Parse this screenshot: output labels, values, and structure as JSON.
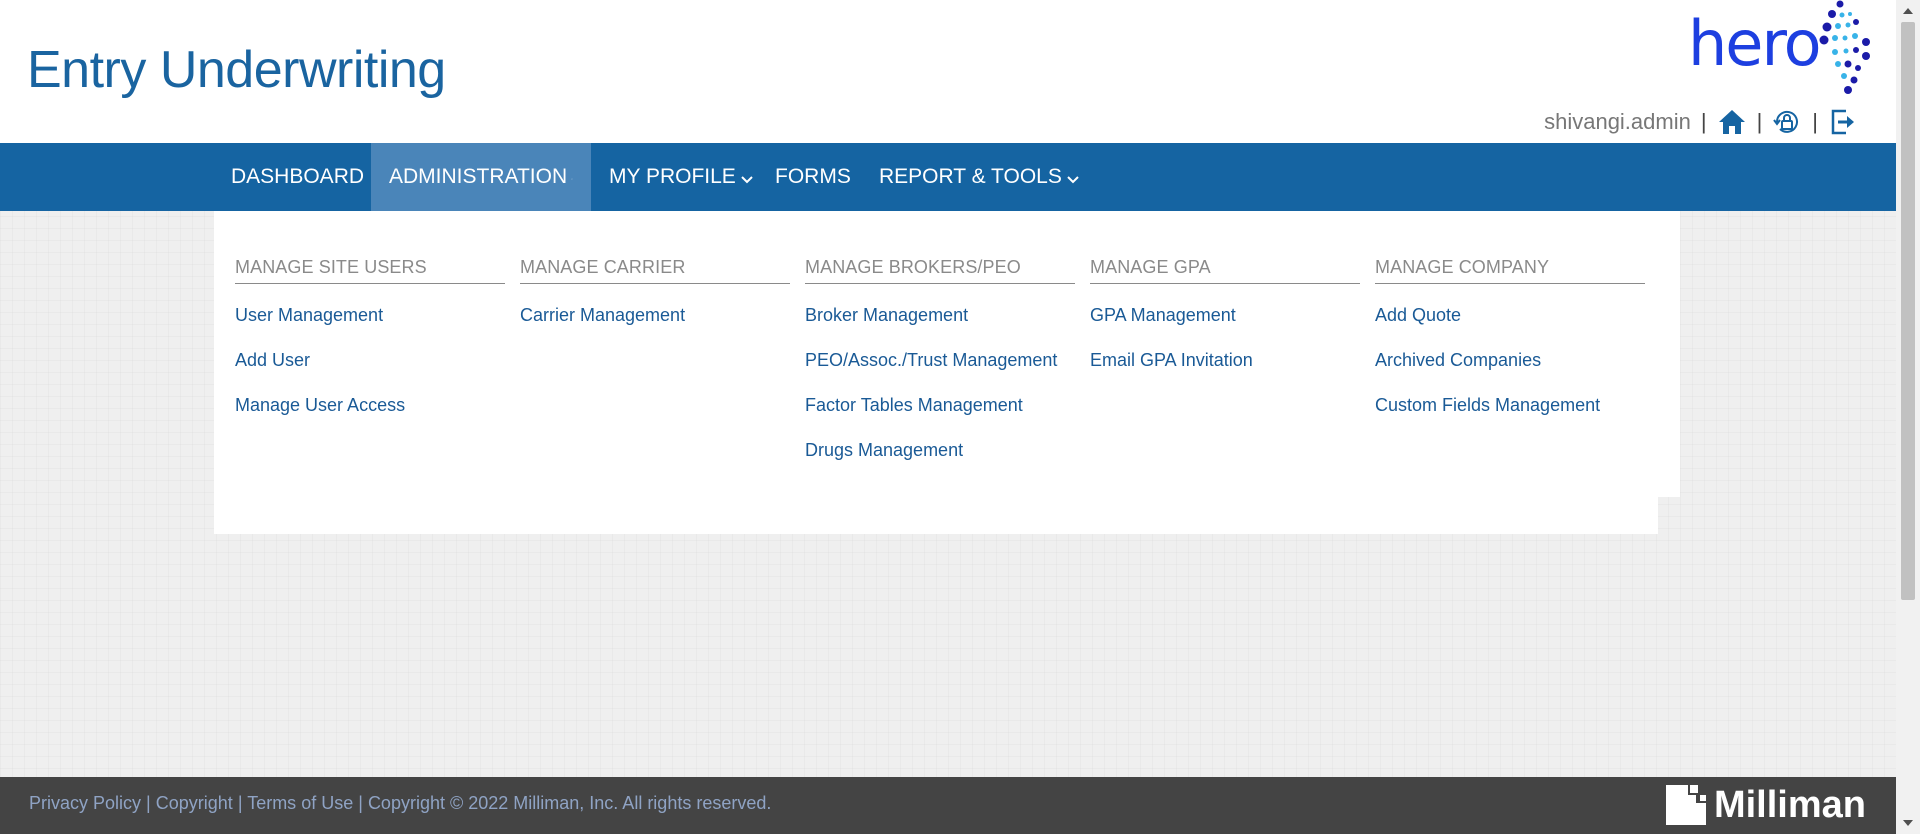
{
  "header": {
    "app_title": "Entry Underwriting",
    "logo_text": "hero",
    "username": "shivangi.admin",
    "separator": "|"
  },
  "nav": {
    "items": [
      {
        "label": "DASHBOARD"
      },
      {
        "label": "ADMINISTRATION"
      },
      {
        "label": "MY PROFILE"
      },
      {
        "label": "FORMS"
      },
      {
        "label": "REPORT & TOOLS"
      }
    ]
  },
  "menu": {
    "columns": [
      {
        "heading": "MANAGE SITE USERS",
        "links": [
          "User Management",
          "Add User",
          "Manage User Access"
        ]
      },
      {
        "heading": "MANAGE CARRIER",
        "links": [
          "Carrier Management"
        ]
      },
      {
        "heading": "MANAGE BROKERS/PEO",
        "links": [
          "Broker Management",
          "PEO/Assoc./Trust Management",
          "Factor Tables Management",
          "Drugs Management"
        ]
      },
      {
        "heading": "MANAGE GPA",
        "links": [
          "GPA Management",
          "Email GPA Invitation"
        ]
      },
      {
        "heading": "MANAGE COMPANY",
        "links": [
          "Add Quote",
          "Archived Companies",
          "Custom Fields Management"
        ]
      }
    ]
  },
  "footer": {
    "privacy": "Privacy Policy",
    "copyright": "Copyright",
    "terms": "Terms of Use",
    "notice": "Copyright © 2022 Milliman, Inc. All rights reserved.",
    "sep": "|",
    "brand": "Milliman"
  },
  "icons": {
    "home": "home-icon",
    "lock": "lock-reset-icon",
    "logout": "logout-icon"
  },
  "colors": {
    "primary": "#1564a2",
    "active_nav": "#4a85b9",
    "link": "#1a5a96",
    "footer_bg": "#444444"
  }
}
